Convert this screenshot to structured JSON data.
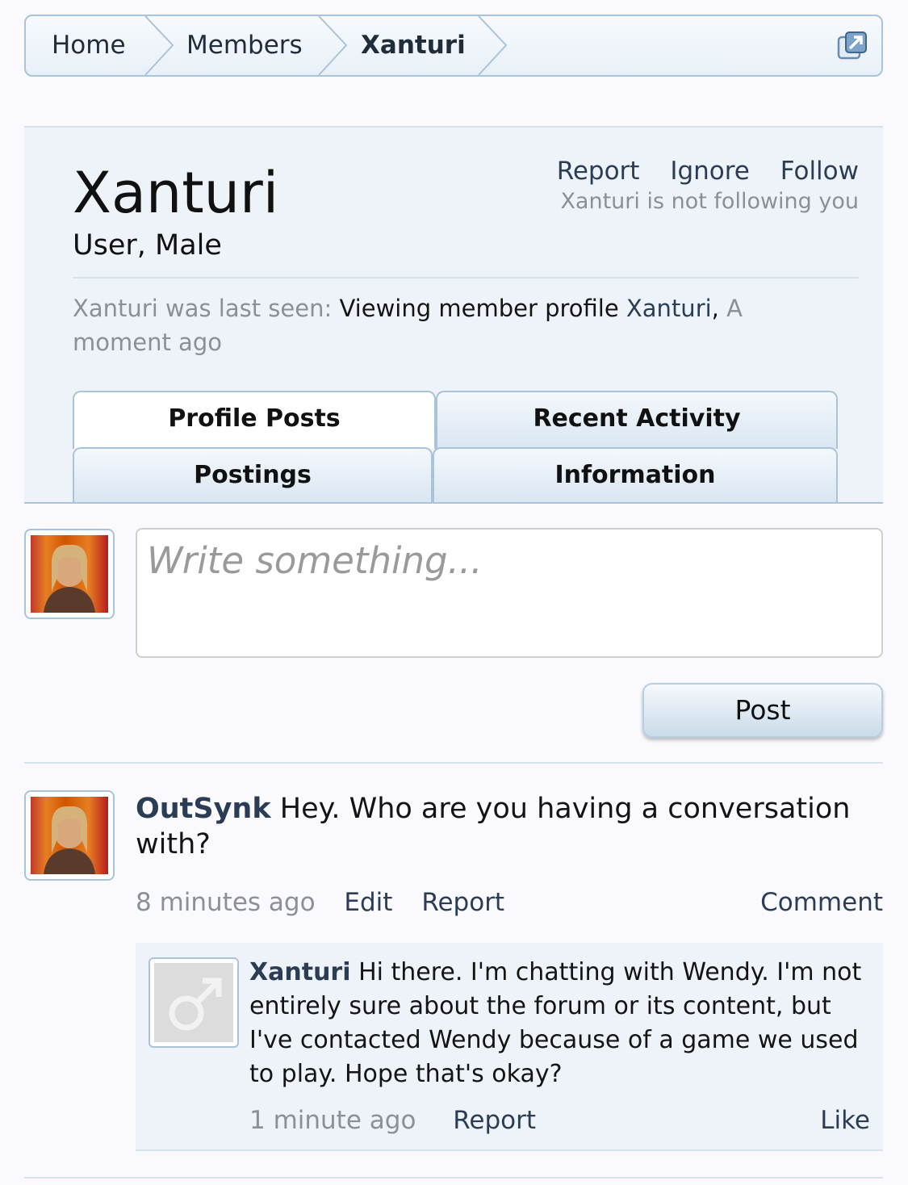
{
  "breadcrumb": {
    "items": [
      "Home",
      "Members",
      "Xanturi"
    ]
  },
  "profile": {
    "username": "Xanturi",
    "user_title": "User, Male",
    "actions": {
      "report": "Report",
      "ignore": "Ignore",
      "follow": "Follow"
    },
    "follow_status": "Xanturi is not following you",
    "last_seen_label": "Xanturi was last seen:",
    "last_seen_activity": "Viewing member profile",
    "last_seen_link": "Xanturi",
    "last_seen_time": "A moment ago"
  },
  "tabs": [
    "Profile Posts",
    "Recent Activity",
    "Postings",
    "Information"
  ],
  "composer": {
    "placeholder": "Write something...",
    "post_label": "Post"
  },
  "message": {
    "author": "OutSynk",
    "text": "Hey. Who are you having a conversation with?",
    "time": "8 minutes ago",
    "edit": "Edit",
    "report": "Report",
    "comment": "Comment"
  },
  "comment": {
    "author": "Xanturi",
    "text": "Hi there. I'm chatting with Wendy. I'm not entirely sure about the forum or its content, but I've contacted Wendy because of a game we used to play. Hope that's okay?",
    "time": "1 minute ago",
    "report": "Report",
    "like": "Like"
  },
  "colors": {
    "link": "#2b3d55",
    "muted": "#8a8f98",
    "border": "#a9c3d9",
    "panel": "#eef3f9"
  }
}
